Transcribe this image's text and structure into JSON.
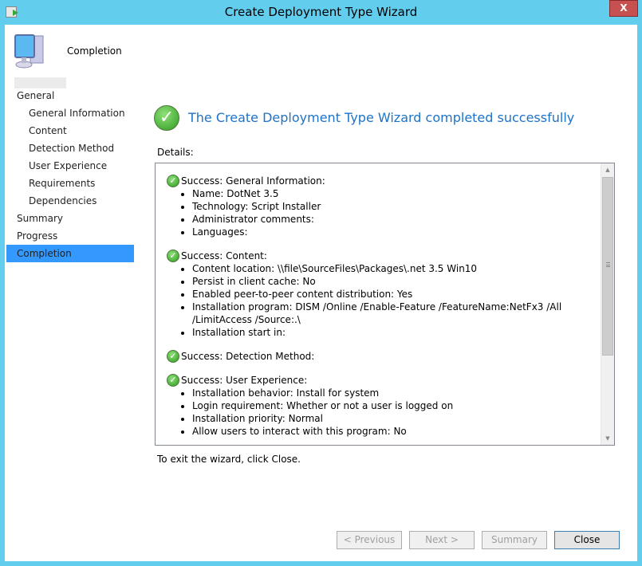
{
  "window": {
    "title": "Create Deployment Type Wizard",
    "close_label": "X",
    "icon": "wizard-app-icon"
  },
  "header": {
    "label": "Completion",
    "icon": "computer-icon"
  },
  "sidebar": {
    "items": [
      {
        "label": "General",
        "level": 0,
        "active": false
      },
      {
        "label": "General Information",
        "level": 1,
        "active": false
      },
      {
        "label": "Content",
        "level": 1,
        "active": false
      },
      {
        "label": "Detection Method",
        "level": 1,
        "active": false
      },
      {
        "label": "User Experience",
        "level": 1,
        "active": false
      },
      {
        "label": "Requirements",
        "level": 1,
        "active": false
      },
      {
        "label": "Dependencies",
        "level": 1,
        "active": false
      },
      {
        "label": "Summary",
        "level": 0,
        "active": false
      },
      {
        "label": "Progress",
        "level": 0,
        "active": false
      },
      {
        "label": "Completion",
        "level": 0,
        "active": true
      }
    ]
  },
  "main": {
    "headline": "The Create Deployment Type Wizard completed successfully",
    "details_label": "Details:",
    "sections": [
      {
        "title": "Success: General Information:",
        "items": [
          "Name: DotNet 3.5",
          "Technology: Script Installer",
          "Administrator comments:",
          "Languages:"
        ]
      },
      {
        "title": "Success: Content:",
        "items": [
          "Content location: \\\\file\\SourceFiles\\Packages\\.net 3.5 Win10",
          "Persist in client cache: No",
          "Enabled peer-to-peer content distribution: Yes",
          "Installation program: DISM /Online /Enable-Feature /FeatureName:NetFx3 /All /LimitAccess /Source:.\\",
          "Installation start in:"
        ]
      },
      {
        "title": "Success: Detection Method:",
        "items": []
      },
      {
        "title": "Success: User Experience:",
        "items": [
          "Installation behavior: Install for system",
          "Login requirement: Whether or not a user is logged on",
          "Installation priority: Normal",
          "Allow users to interact with this program: No"
        ]
      }
    ],
    "exit_text": "To exit the wizard, click Close."
  },
  "buttons": {
    "previous": "< Previous",
    "next": "Next >",
    "summary": "Summary",
    "close": "Close"
  },
  "colors": {
    "titlebar": "#63cdee",
    "accent_text": "#1e73c8",
    "selection": "#3399ff",
    "close_button": "#c75050"
  }
}
